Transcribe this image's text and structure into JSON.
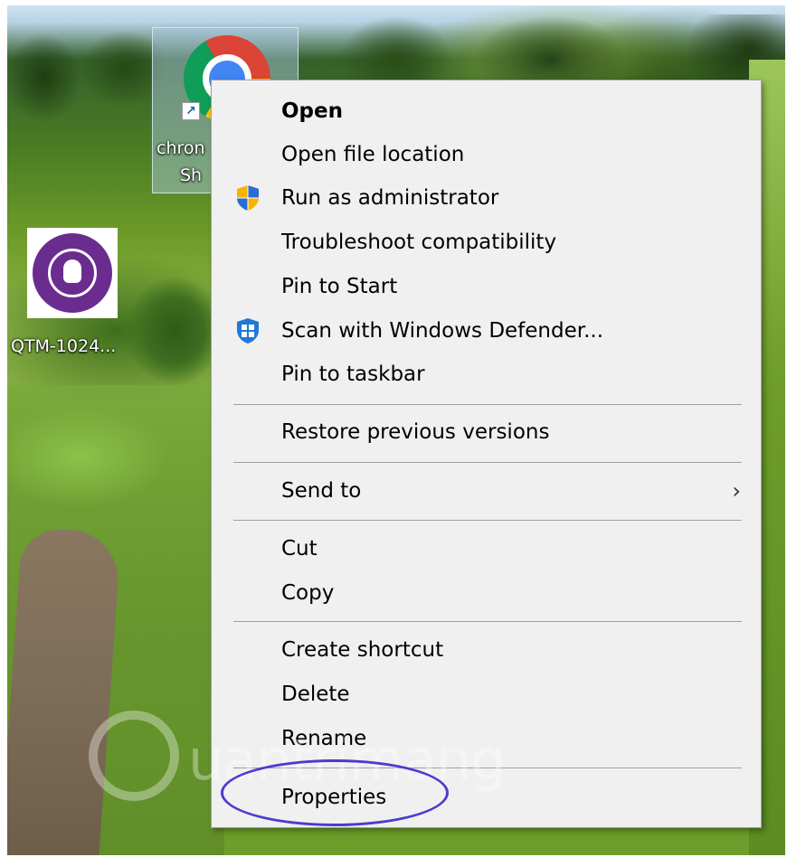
{
  "desktop": {
    "icons": [
      {
        "label_line1": "chron",
        "label_line2": "Sh"
      },
      {
        "label": "QTM-1024..."
      }
    ]
  },
  "context_menu": {
    "items": [
      {
        "label": "Open",
        "bold": true,
        "icon": ""
      },
      {
        "label": "Open file location",
        "icon": ""
      },
      {
        "label": "Run as administrator",
        "icon": "uac-shield-icon"
      },
      {
        "label": "Troubleshoot compatibility",
        "icon": ""
      },
      {
        "label": "Pin to Start",
        "icon": ""
      },
      {
        "label": "Scan with Windows Defender...",
        "icon": "windows-defender-icon"
      },
      {
        "label": "Pin to taskbar",
        "icon": ""
      },
      {
        "label": "Restore previous versions",
        "icon": ""
      },
      {
        "label": "Send to",
        "icon": "",
        "submenu_arrow": "›"
      },
      {
        "label": "Cut",
        "icon": ""
      },
      {
        "label": "Copy",
        "icon": ""
      },
      {
        "label": "Create shortcut",
        "icon": ""
      },
      {
        "label": "Delete",
        "icon": ""
      },
      {
        "label": "Rename",
        "icon": ""
      },
      {
        "label": "Properties",
        "icon": ""
      }
    ]
  },
  "watermark": {
    "text": "uantrimang"
  },
  "colors": {
    "menu_bg": "#f0f0f0",
    "separator": "#a0a0a0",
    "highlight_oval": "#4b3ccf"
  }
}
